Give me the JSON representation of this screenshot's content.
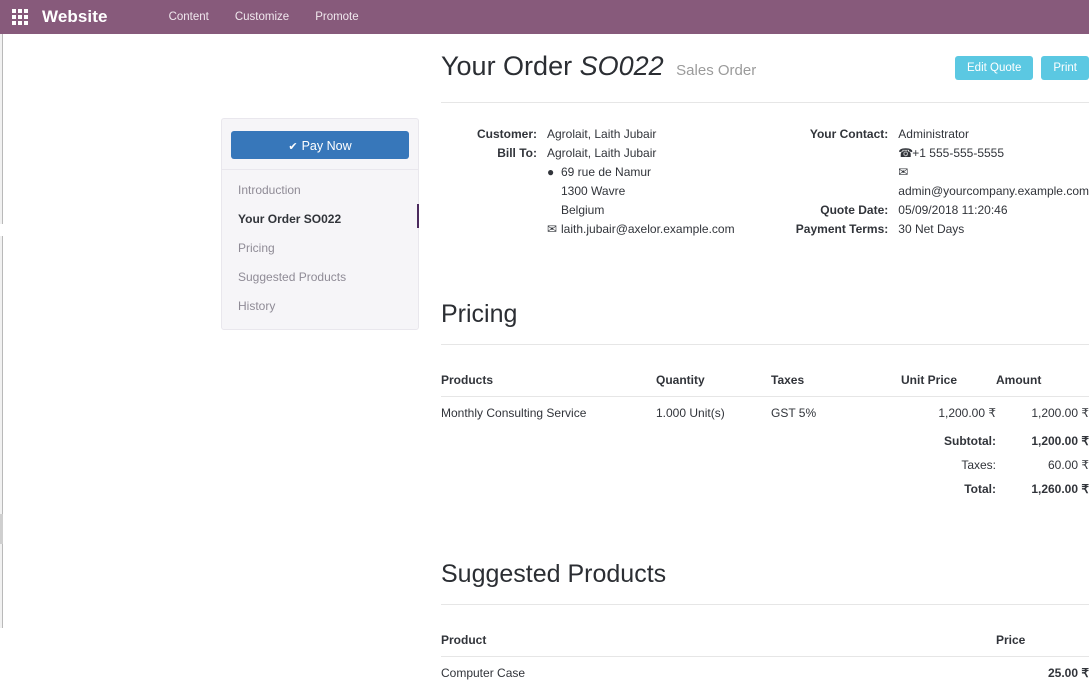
{
  "topbar": {
    "apps_icon": "apps-grid-icon",
    "brand": "Website",
    "nav": [
      {
        "label": "Content"
      },
      {
        "label": "Customize"
      },
      {
        "label": "Promote"
      }
    ],
    "background_color": "#875a7b"
  },
  "sidebar": {
    "pay_now_label": "Pay Now",
    "pay_now_icon": "check-icon",
    "pay_now_color": "#3777ba",
    "active_indicator_color": "#4b2a5e",
    "items": [
      {
        "label": "Introduction",
        "active": false
      },
      {
        "label": "Your Order SO022",
        "active": true
      },
      {
        "label": "Pricing",
        "active": false
      },
      {
        "label": "Suggested Products",
        "active": false
      },
      {
        "label": "History",
        "active": false
      }
    ]
  },
  "header": {
    "title_prefix": "Your Order",
    "order_ref": "SO022",
    "subtitle": "Sales Order",
    "buttons": [
      {
        "label": "Edit Quote"
      },
      {
        "label": "Print"
      }
    ],
    "button_color": "#5bc8e2"
  },
  "address": {
    "left": {
      "labels": {
        "customer": "Customer:",
        "bill_to": "Bill To:"
      },
      "customer_name": "Agrolait, Laith Jubair",
      "bill_to_name": "Agrolait, Laith Jubair",
      "street": "69 rue de Namur",
      "city": "1300 Wavre",
      "country": "Belgium",
      "email": "laith.jubair@axelor.example.com",
      "street_icon": "map-pin-icon",
      "email_icon": "envelope-icon"
    },
    "right": {
      "labels": {
        "your_contact": "Your Contact:",
        "quote_date": "Quote Date:",
        "payment_terms": "Payment Terms:"
      },
      "contact_name": "Administrator",
      "phone": "+1 555-555-5555",
      "email": "admin@yourcompany.example.com",
      "quote_date": "05/09/2018 11:20:46",
      "payment_terms": "30 Net Days",
      "phone_icon": "phone-icon",
      "email_icon": "envelope-icon"
    }
  },
  "pricing": {
    "title": "Pricing",
    "columns": {
      "products": "Products",
      "quantity": "Quantity",
      "taxes": "Taxes",
      "unit_price": "Unit Price",
      "amount": "Amount"
    },
    "rows": [
      {
        "product": "Monthly Consulting Service",
        "quantity": "1.000 Unit(s)",
        "taxes": "GST 5%",
        "unit_price": "1,200.00 ₹",
        "amount": "1,200.00 ₹"
      }
    ],
    "totals": [
      {
        "label": "Subtotal:",
        "value": "1,200.00 ₹",
        "bold": true
      },
      {
        "label": "Taxes:",
        "value": "60.00 ₹",
        "bold": false
      },
      {
        "label": "Total:",
        "value": "1,260.00 ₹",
        "bold": true
      }
    ]
  },
  "suggested": {
    "title": "Suggested Products",
    "columns": {
      "product": "Product",
      "price": "Price"
    },
    "rows": [
      {
        "product": "Computer Case",
        "price": "25.00 ₹"
      }
    ]
  }
}
